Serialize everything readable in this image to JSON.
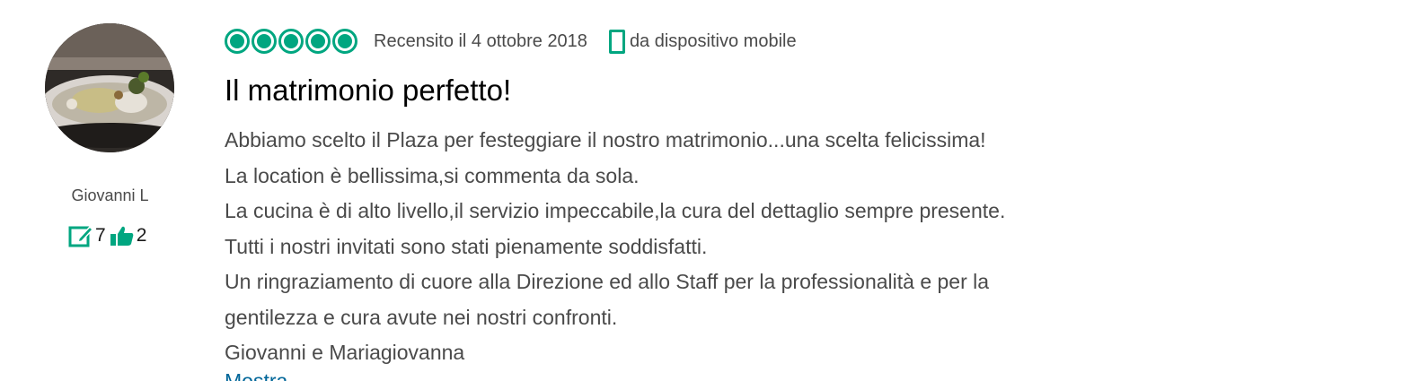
{
  "reviewer": {
    "name": "Giovanni L",
    "contributions": "7",
    "helpful_votes": "2",
    "avatar_icon": "avatar-photo-food",
    "contributions_icon": "edit-review-icon",
    "helpful_icon": "thumbs-up-icon"
  },
  "review": {
    "rating": 5,
    "rating_max": 5,
    "date_text": "Recensito il 4 ottobre 2018",
    "device_text": "da dispositivo mobile",
    "device_icon": "mobile-phone-icon",
    "title": "Il matrimonio perfetto!",
    "body_lines": [
      "Abbiamo scelto il Plaza per festeggiare il nostro matrimonio...una scelta felicissima!",
      "La location è bellissima,si commenta da sola.",
      "La cucina è di alto livello,il servizio impeccabile,la cura del dettaglio sempre presente.",
      "Tutti i nostri invitati sono stati pienamente soddisfatti.",
      "Un ringraziamento di cuore alla Direzione ed allo Staff per la professionalità e per la",
      "gentilezza e cura avute nei nostri confronti.",
      "Giovanni e Mariagiovanna"
    ],
    "more_link": "Mostra"
  },
  "colors": {
    "accent": "#00a680",
    "text": "#4a4a4a",
    "title": "#000000",
    "link": "#006699"
  }
}
